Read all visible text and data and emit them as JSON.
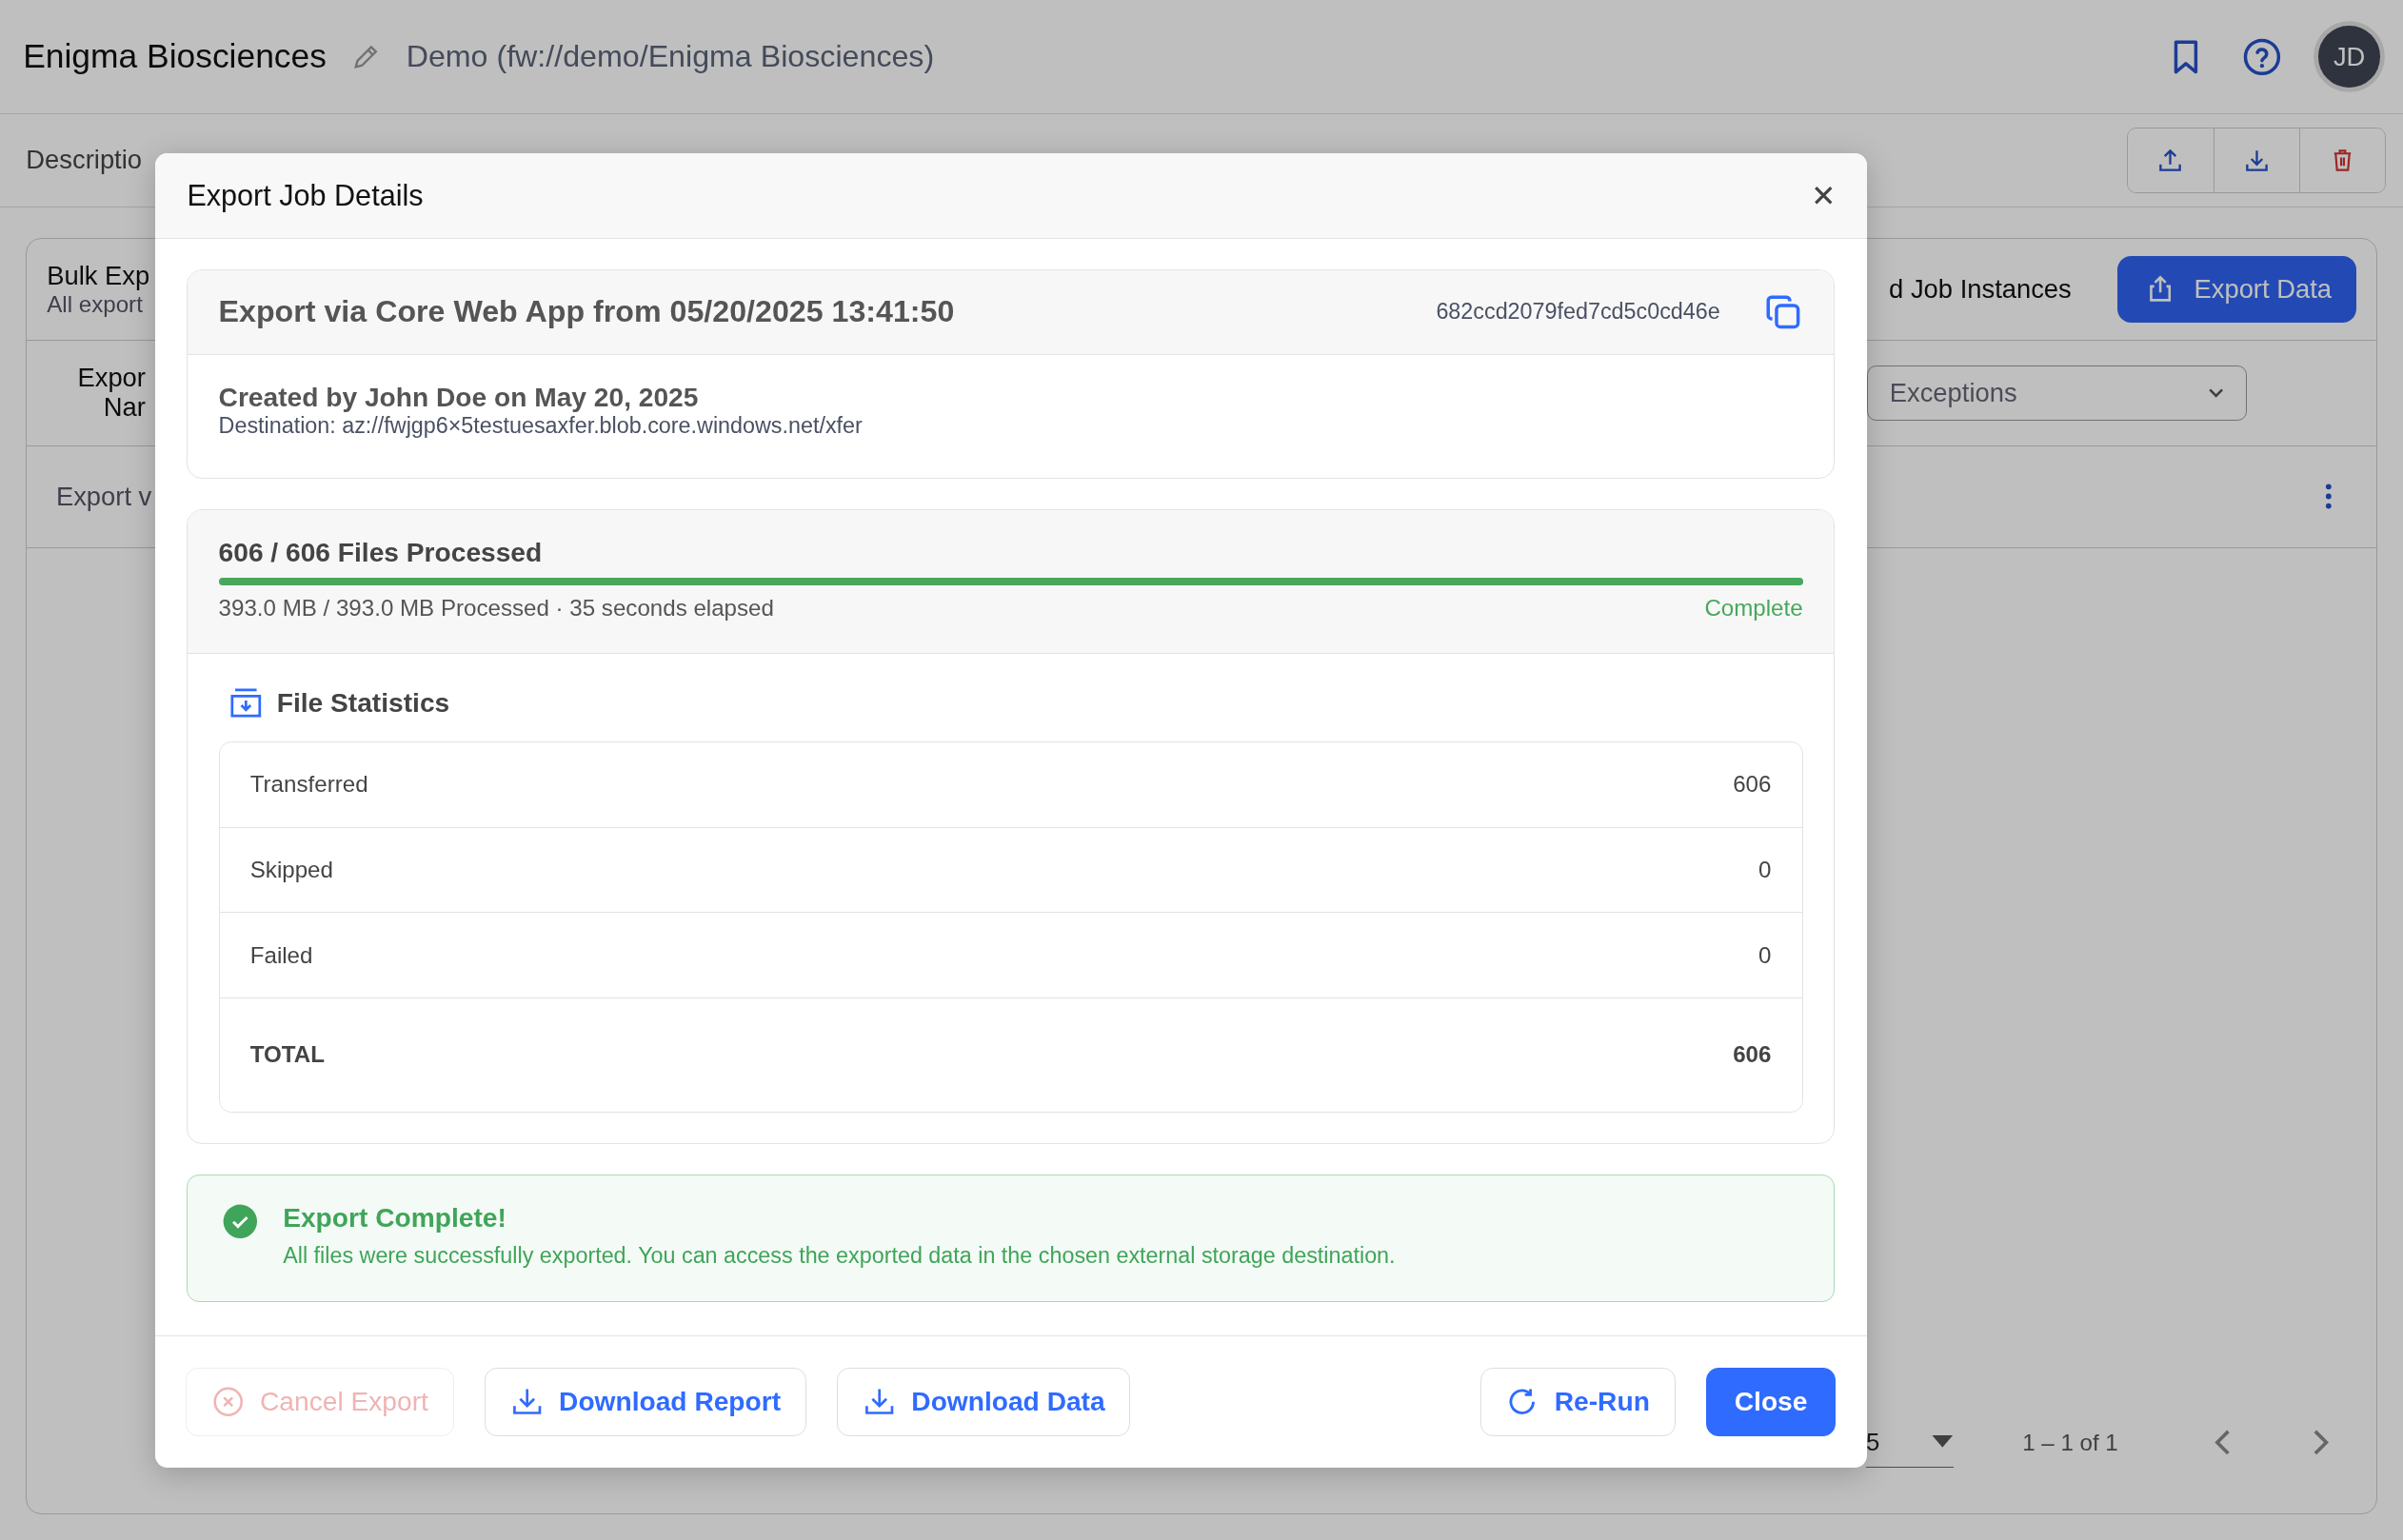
{
  "header": {
    "title": "Enigma Biosciences",
    "subtitle": "Demo (fw://demo/Enigma Biosciences)",
    "avatar": "JD"
  },
  "tabs": [
    {
      "label": "Descriptio"
    }
  ],
  "panel": {
    "title": "Bulk Exp",
    "subtitle": "All export",
    "right_title": "d Job Instances",
    "export_button": "Export Data",
    "column_header": [
      "Expor",
      "Nar"
    ],
    "filter": "Exceptions",
    "row_text": "Export v",
    "page_size": "5",
    "range": "1 – 1 of 1"
  },
  "modal": {
    "title": "Export Job Details",
    "job": {
      "title": "Export via Core Web App from 05/20/2025 13:41:50",
      "id": "682ccd2079fed7cd5c0cd46e",
      "created": "Created by John Doe on May 20, 2025",
      "destination": "Destination: az://fwjgp6×5testuesaxfer.blob.core.windows.net/xfer"
    },
    "progress": {
      "files": "606 / 606 Files Processed",
      "level": 1,
      "details": "393.0 MB / 393.0 MB Processed · 35 seconds elapsed",
      "status": "Complete"
    },
    "stats": {
      "title": "File Statistics",
      "rows": [
        {
          "label": "Transferred",
          "value": "606",
          "kind": "row"
        },
        {
          "label": "Skipped",
          "value": "0",
          "kind": "row"
        },
        {
          "label": "Failed",
          "value": "0",
          "kind": "row"
        },
        {
          "label": "TOTAL",
          "value": "606",
          "kind": "total"
        }
      ]
    },
    "alert": {
      "title": "Export Complete!",
      "message": "All files were successfully exported. You can access the exported data in the chosen external storage destination."
    },
    "buttons": [
      {
        "label": "Cancel Export",
        "kind": "cancel",
        "disabled": true
      },
      {
        "label": "Download Report",
        "kind": "download",
        "disabled": false
      },
      {
        "label": "Download Data",
        "kind": "download",
        "disabled": false
      },
      {
        "label": "Re-Run",
        "kind": "rerun",
        "disabled": false
      },
      {
        "label": "Close",
        "kind": "primary",
        "disabled": false
      }
    ]
  }
}
